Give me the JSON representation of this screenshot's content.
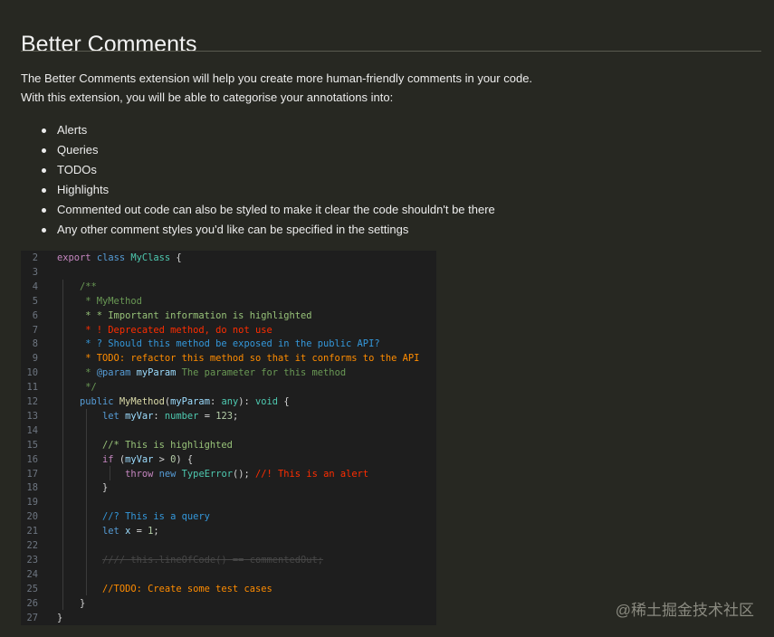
{
  "page": {
    "title": "Better Comments",
    "intro_line1": "The Better Comments extension will help you create more human-friendly comments in your code.",
    "intro_line2": "With this extension, you will be able to categorise your annotations into:",
    "bullets": [
      "Alerts",
      "Queries",
      "TODOs",
      "Highlights",
      "Commented out code can also be styled to make it clear the code shouldn't be there",
      "Any other comment styles you'd like can be specified in the settings"
    ]
  },
  "code": {
    "lines": [
      {
        "n": "2",
        "t": [
          [
            "export",
            "kw2"
          ],
          [
            " ",
            ""
          ],
          [
            "class",
            "kw"
          ],
          [
            " ",
            ""
          ],
          [
            "MyClass",
            "ty"
          ],
          [
            " {",
            "pl"
          ]
        ]
      },
      {
        "n": "3",
        "t": []
      },
      {
        "n": "4",
        "t": [
          [
            "    /**",
            "cm"
          ]
        ]
      },
      {
        "n": "5",
        "t": [
          [
            "     * MyMethod",
            "cm"
          ]
        ]
      },
      {
        "n": "6",
        "t": [
          [
            "     * * Important information is highlighted",
            "hl"
          ]
        ]
      },
      {
        "n": "7",
        "t": [
          [
            "     * ! Deprecated method, do not use",
            "al"
          ]
        ]
      },
      {
        "n": "8",
        "t": [
          [
            "     * ? Should this method be exposed in the public API?",
            "qu"
          ]
        ]
      },
      {
        "n": "9",
        "t": [
          [
            "     * TODO: refactor this method so that it conforms to the API",
            "td"
          ]
        ]
      },
      {
        "n": "10",
        "t": [
          [
            "     * ",
            "cm"
          ],
          [
            "@param",
            "kw"
          ],
          [
            " ",
            ""
          ],
          [
            "myParam",
            "vr"
          ],
          [
            " The parameter for this method",
            "cm"
          ]
        ]
      },
      {
        "n": "11",
        "t": [
          [
            "     */",
            "cm"
          ]
        ]
      },
      {
        "n": "12",
        "t": [
          [
            "    ",
            ""
          ],
          [
            "public",
            "kw"
          ],
          [
            " ",
            ""
          ],
          [
            "MyMethod",
            "fn"
          ],
          [
            "(",
            "pl"
          ],
          [
            "myParam",
            "vr"
          ],
          [
            ": ",
            "pl"
          ],
          [
            "any",
            "ty"
          ],
          [
            "): ",
            "pl"
          ],
          [
            "void",
            "ty"
          ],
          [
            " {",
            "pl"
          ]
        ]
      },
      {
        "n": "13",
        "t": [
          [
            "        ",
            ""
          ],
          [
            "let",
            "kw"
          ],
          [
            " ",
            ""
          ],
          [
            "myVar",
            "vr"
          ],
          [
            ": ",
            "pl"
          ],
          [
            "number",
            "ty"
          ],
          [
            " = ",
            "pl"
          ],
          [
            "123",
            "nm"
          ],
          [
            ";",
            "pl"
          ]
        ]
      },
      {
        "n": "14",
        "t": []
      },
      {
        "n": "15",
        "t": [
          [
            "        //* This is highlighted",
            "hl"
          ]
        ]
      },
      {
        "n": "16",
        "t": [
          [
            "        ",
            ""
          ],
          [
            "if",
            "kw2"
          ],
          [
            " (",
            "pl"
          ],
          [
            "myVar",
            "vr"
          ],
          [
            " > ",
            "pl"
          ],
          [
            "0",
            "nm"
          ],
          [
            ") {",
            "pl"
          ]
        ]
      },
      {
        "n": "17",
        "t": [
          [
            "            ",
            ""
          ],
          [
            "throw",
            "kw2"
          ],
          [
            " ",
            ""
          ],
          [
            "new",
            "kw"
          ],
          [
            " ",
            ""
          ],
          [
            "TypeError",
            "ty"
          ],
          [
            "(); ",
            "pl"
          ],
          [
            "//! This is an alert",
            "al"
          ]
        ]
      },
      {
        "n": "18",
        "t": [
          [
            "        }",
            "pl"
          ]
        ]
      },
      {
        "n": "19",
        "t": []
      },
      {
        "n": "20",
        "t": [
          [
            "        //? This is a query",
            "qu"
          ]
        ]
      },
      {
        "n": "21",
        "t": [
          [
            "        ",
            ""
          ],
          [
            "let",
            "kw"
          ],
          [
            " ",
            ""
          ],
          [
            "x",
            "vr"
          ],
          [
            " = ",
            "pl"
          ],
          [
            "1",
            "nm"
          ],
          [
            ";",
            "pl"
          ]
        ]
      },
      {
        "n": "22",
        "t": []
      },
      {
        "n": "23",
        "t": [
          [
            "        ",
            ""
          ],
          [
            "//// this.lineOfCode() == commentedOut;",
            "st"
          ]
        ]
      },
      {
        "n": "24",
        "t": []
      },
      {
        "n": "25",
        "t": [
          [
            "        //TODO: Create some test cases",
            "td"
          ]
        ]
      },
      {
        "n": "26",
        "t": [
          [
            "    }",
            "pl"
          ]
        ]
      },
      {
        "n": "27",
        "t": [
          [
            "}",
            "pl"
          ]
        ]
      }
    ]
  },
  "watermark": "@稀土掘金技术社区"
}
